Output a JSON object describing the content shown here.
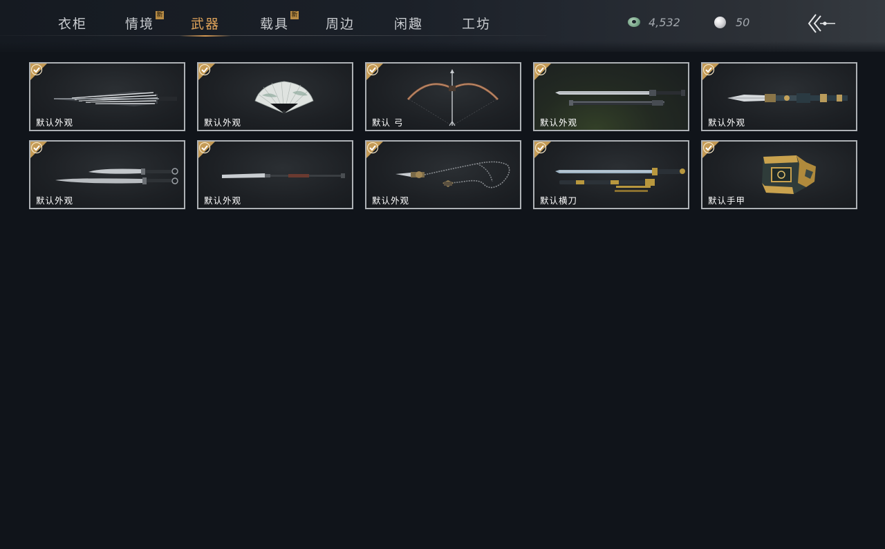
{
  "tabs": [
    {
      "label": "衣柜",
      "new_badge": ""
    },
    {
      "label": "情境",
      "new_badge": "新"
    },
    {
      "label": "武器",
      "new_badge": "",
      "active": true
    },
    {
      "label": "载具",
      "new_badge": "新"
    },
    {
      "label": "周边",
      "new_badge": ""
    },
    {
      "label": "闲趣",
      "new_badge": ""
    },
    {
      "label": "工坊",
      "new_badge": ""
    }
  ],
  "currency": {
    "jade": {
      "icon": "jade-coin-icon",
      "value": "4,532"
    },
    "pearl": {
      "icon": "pearl-icon",
      "value": "50"
    }
  },
  "back_button": {
    "icon": "back-arrow-icon"
  },
  "items": [
    {
      "label": "默认外观",
      "icon": "umbrella-weapon-icon",
      "equipped": true
    },
    {
      "label": "默认外观",
      "icon": "folding-fan-icon",
      "equipped": true
    },
    {
      "label": "默认 弓",
      "icon": "bow-icon",
      "equipped": true
    },
    {
      "label": "默认外观",
      "icon": "spear-sword-icon",
      "equipped": true
    },
    {
      "label": "默认外观",
      "icon": "spear-icon",
      "equipped": true
    },
    {
      "label": "默认外观",
      "icon": "dual-blades-icon",
      "equipped": true
    },
    {
      "label": "默认外观",
      "icon": "glaive-icon",
      "equipped": true
    },
    {
      "label": "默认外观",
      "icon": "rope-dart-icon",
      "equipped": true
    },
    {
      "label": "默认横刀",
      "icon": "hengdao-sword-icon",
      "equipped": true
    },
    {
      "label": "默认手甲",
      "icon": "gauntlet-icon",
      "equipped": true
    }
  ],
  "colors": {
    "active_tab": "#e0a45a",
    "check_badge": "#c49a55",
    "card_border": "#aeb2b6"
  }
}
